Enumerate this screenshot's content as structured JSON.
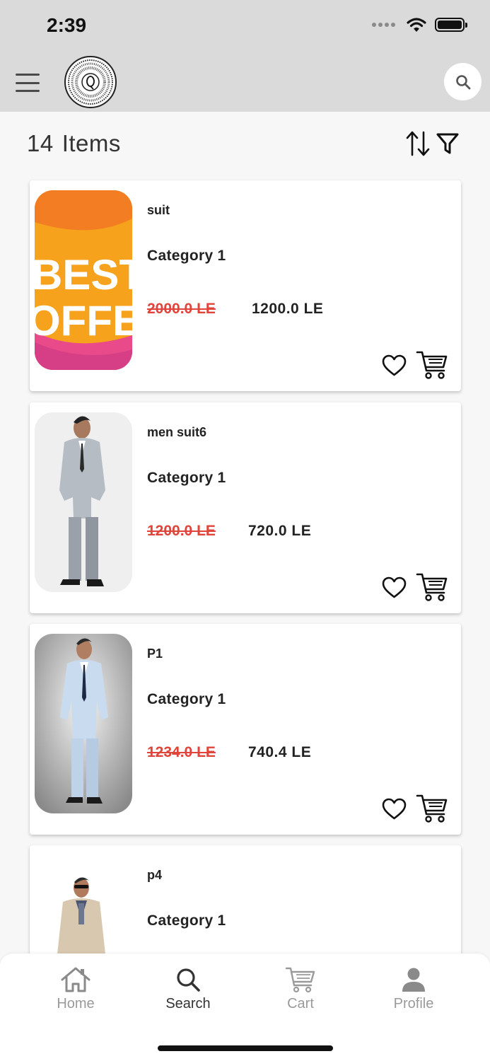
{
  "status_bar": {
    "time": "2:39"
  },
  "header": {
    "menu_icon": "hamburger-menu-icon",
    "logo_icon": "brand-logo",
    "search_icon": "search-icon"
  },
  "listing": {
    "count": "14",
    "count_label": "Items",
    "sort_icon": "sort-icon",
    "filter_icon": "filter-icon"
  },
  "products": [
    {
      "name": "suit",
      "category": "Category 1",
      "old_price": "2000.0 LE",
      "price": "1200.0 LE",
      "image_text": [
        "BEST",
        "OFFER"
      ]
    },
    {
      "name": "men suit6",
      "category": "Category 1",
      "old_price": "1200.0 LE",
      "price": "720.0 LE"
    },
    {
      "name": "P1",
      "category": "Category 1",
      "old_price": "1234.0 LE",
      "price": "740.4 LE"
    },
    {
      "name": "p4",
      "category": "Category 1"
    }
  ],
  "tabs": [
    {
      "label": "Home",
      "icon": "home-icon",
      "active": false
    },
    {
      "label": "Search",
      "icon": "search-icon",
      "active": true
    },
    {
      "label": "Cart",
      "icon": "cart-icon",
      "active": false
    },
    {
      "label": "Profile",
      "icon": "profile-icon",
      "active": false
    }
  ],
  "colors": {
    "header_bg": "#dadada",
    "old_price": "#e0443a",
    "active_tab": "#333333",
    "inactive_tab": "#9a9a9a"
  }
}
